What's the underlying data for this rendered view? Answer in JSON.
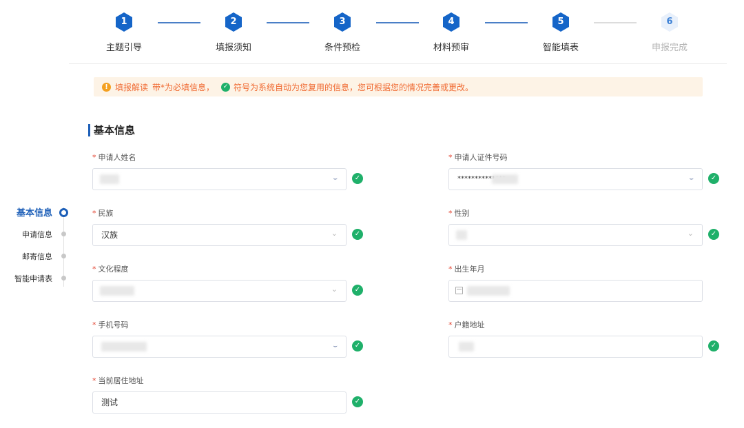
{
  "stepper": {
    "steps": [
      {
        "num": "1",
        "label": "主题引导"
      },
      {
        "num": "2",
        "label": "填报须知"
      },
      {
        "num": "3",
        "label": "条件预检"
      },
      {
        "num": "4",
        "label": "材料预审"
      },
      {
        "num": "5",
        "label": "智能填表"
      },
      {
        "num": "6",
        "label": "申报完成"
      }
    ],
    "active_color": "#1565c8",
    "pending_color": "#e8f0fb"
  },
  "notice": {
    "title": "填报解读",
    "text1": "带*为必填信息，",
    "text2": "符号为系统自动为您复用的信息，您可根据您的情况完善或更改。",
    "color": "#f06a32"
  },
  "section": {
    "title": "基本信息"
  },
  "sidenav": {
    "items": [
      {
        "label": "基本信息"
      },
      {
        "label": "申请信息"
      },
      {
        "label": "邮寄信息"
      },
      {
        "label": "智能申请表"
      }
    ]
  },
  "form": {
    "required_mark": "*",
    "name_label": "申请人姓名",
    "id_label": "申请人证件号码",
    "id_value": "**************",
    "ethnicity_label": "民族",
    "ethnicity_value": "汉族",
    "gender_label": "性别",
    "education_label": "文化程度",
    "birth_label": "出生年月",
    "phone_label": "手机号码",
    "hukou_label": "户籍地址",
    "address_label": "当前居住地址",
    "address_value": "测试"
  },
  "icons": {
    "eye": "eye-closed-icon",
    "chevron": "chevron-down-icon",
    "calendar": "calendar-icon",
    "check": "check-circle-icon",
    "warning": "warning-icon"
  },
  "colors": {
    "brand": "#1d5fb8",
    "ok": "#1fb06a",
    "required": "#e2412e"
  }
}
